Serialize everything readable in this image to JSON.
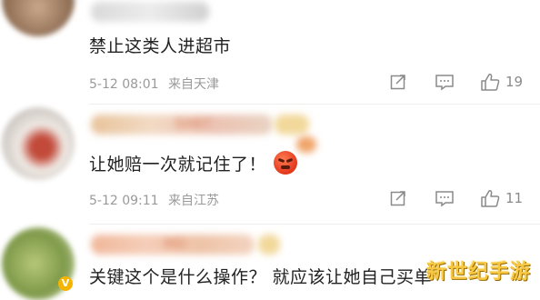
{
  "comments": [
    {
      "text": "禁止这类人进超市",
      "date": "5-12 08:01",
      "location": "来自天津",
      "likes": "19",
      "actions": {
        "share": "share-icon",
        "comment": "comment-icon",
        "like": "thumbs-up-icon"
      }
    },
    {
      "username_visible": "SH87",
      "text": "让她赔一次就记住了！",
      "date": "5-12 09:11",
      "location": "来自江苏",
      "likes": "11",
      "emoji": "angry-face"
    },
    {
      "username_visible": "MD",
      "text": "关键这个是什么操作？ 就应该让她自己买单",
      "verified": true
    }
  ],
  "watermark": "新世纪手游",
  "colors": {
    "meta": "#9a9a9a",
    "text": "#222222",
    "watermark": "#f7c844"
  }
}
